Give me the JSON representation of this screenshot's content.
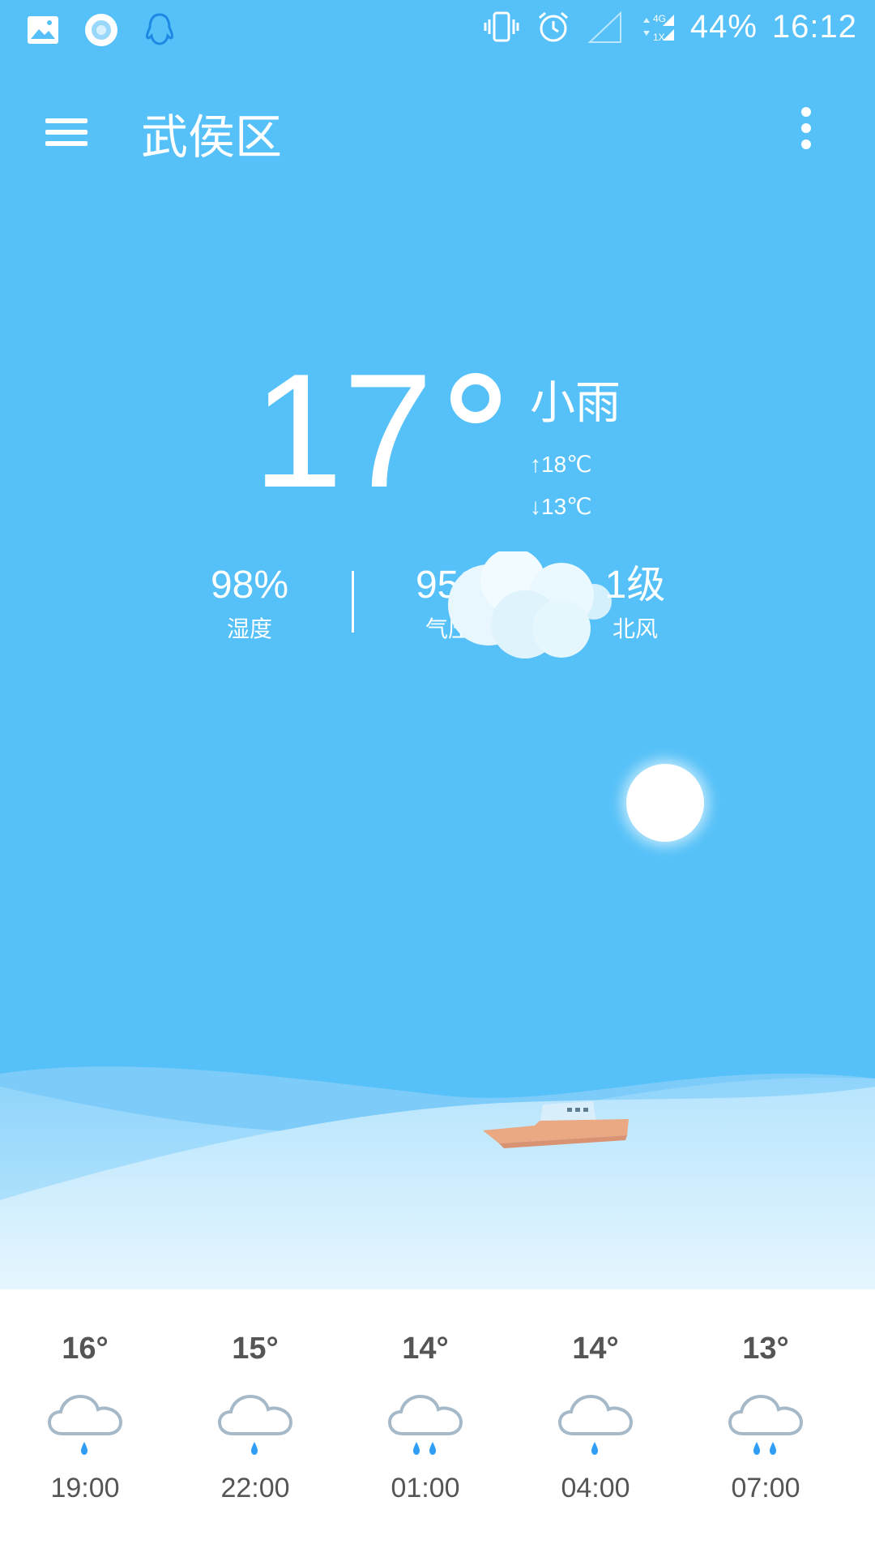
{
  "status_bar": {
    "battery": "44%",
    "time": "16:12",
    "network": "4G",
    "network_sub": "1X",
    "left_icons": [
      "gallery-icon",
      "circle-app-icon",
      "qq-icon"
    ],
    "right_icons": [
      "vibrate-icon",
      "alarm-icon",
      "signal-empty-icon",
      "data-arrows-icon",
      "signal-icon"
    ]
  },
  "header": {
    "city": "武侯区",
    "menu_icon": "menu-icon",
    "more_icon": "more-vert-icon"
  },
  "current": {
    "temperature": "17",
    "condition": "小雨",
    "high": "↑18℃",
    "low": "↓13℃",
    "humidity_value": "98%",
    "humidity_label": "湿度",
    "pressure_value": "952",
    "pressure_label": "气压",
    "wind_value": "1级",
    "wind_label": "北风"
  },
  "scene": {
    "sky_color": "#55c1f8",
    "decorations": [
      "cloud-icon",
      "sun-icon",
      "waves",
      "boat-icon"
    ]
  },
  "forecast": [
    {
      "temp": "16°",
      "time": "19:00",
      "icon": "light-rain-icon",
      "drops": 1
    },
    {
      "temp": "15°",
      "time": "22:00",
      "icon": "light-rain-icon",
      "drops": 1
    },
    {
      "temp": "14°",
      "time": "01:00",
      "icon": "rain-icon",
      "drops": 2
    },
    {
      "temp": "14°",
      "time": "04:00",
      "icon": "light-rain-icon",
      "drops": 1
    },
    {
      "temp": "13°",
      "time": "07:00",
      "icon": "rain-icon",
      "drops": 2
    }
  ]
}
